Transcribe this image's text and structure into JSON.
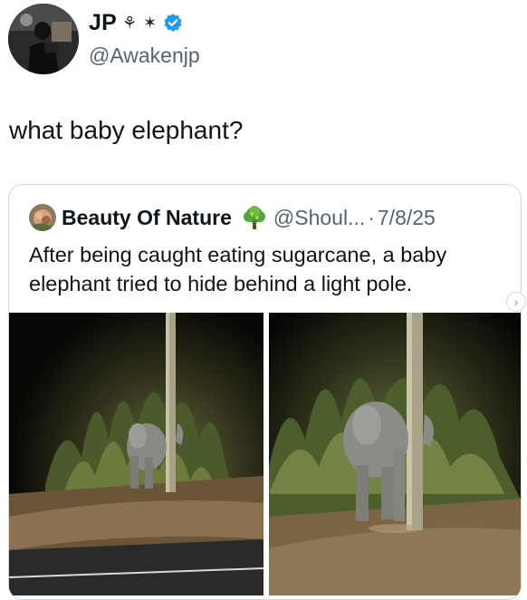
{
  "author": {
    "display_name": "JP",
    "name_emoji": "⚘ ✶",
    "handle": "@Awakenjp",
    "verified": true,
    "avatar_icon": "person-with-camera-avatar"
  },
  "tweet": {
    "text": "what baby elephant?"
  },
  "quoted_tweet": {
    "display_name": "Beauty Of Nature",
    "badge_icon": "tree-badge-icon",
    "handle": "@Shoul...",
    "separator": "·",
    "date": "7/8/25",
    "text": "After being caught eating sugarcane, a baby elephant tried to hide behind a light pole.",
    "photos": [
      {
        "subject": "baby elephant behind light pole at night (wide)"
      },
      {
        "subject": "baby elephant behind light pole at night (close)"
      }
    ]
  },
  "controls": {
    "next_arrow": "›"
  },
  "colors": {
    "verified_blue": "#1d9bf0",
    "secondary_text": "#536471",
    "border": "#cfd9de"
  }
}
